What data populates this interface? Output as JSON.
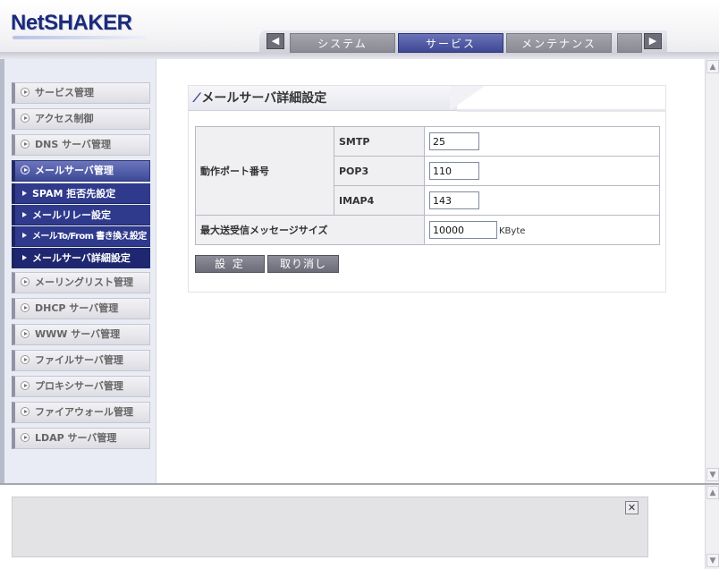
{
  "header": {
    "logo": "NetSHAKER",
    "prev_icon": "left-arrow-icon",
    "next_icon": "right-arrow-icon",
    "tabs": [
      {
        "label": "システム",
        "active": false
      },
      {
        "label": "サービス",
        "active": true
      },
      {
        "label": "メンテナンス",
        "active": false
      }
    ]
  },
  "sidebar": {
    "items_before": [
      {
        "label": "サービス管理"
      },
      {
        "label": "アクセス制御"
      },
      {
        "label": "DNS サーバ管理"
      }
    ],
    "open_item": {
      "label": "メールサーバ管理"
    },
    "sub_items": [
      {
        "label": "SPAM 拒否先設定"
      },
      {
        "label": "メールリレー設定"
      },
      {
        "label": "メールTo/From 書き換え設定"
      },
      {
        "label": "メールサーバ詳細設定"
      }
    ],
    "items_after": [
      {
        "label": "メーリングリスト管理"
      },
      {
        "label": "DHCP サーバ管理"
      },
      {
        "label": "WWW サーバ管理"
      },
      {
        "label": "ファイルサーバ管理"
      },
      {
        "label": "プロキシサーバ管理"
      },
      {
        "label": "ファイアウォール管理"
      },
      {
        "label": "LDAP サーバ管理"
      }
    ]
  },
  "panel": {
    "title": "メールサーバ詳細設定",
    "port_label": "動作ポート番号",
    "smtp_label": "SMTP",
    "smtp_value": "25",
    "pop3_label": "POP3",
    "pop3_value": "110",
    "imap4_label": "IMAP4",
    "imap4_value": "143",
    "max_size_label": "最大送受信メッセージサイズ",
    "max_size_value": "10000",
    "max_size_unit": "KByte",
    "apply_label": "設 定",
    "cancel_label": "取り消し"
  },
  "message_frame": {
    "close_icon": "close-icon"
  },
  "colors": {
    "accent": "#3e4893",
    "tab_inactive": "#8a8a94",
    "sub_nav": "#2f3a8c"
  }
}
